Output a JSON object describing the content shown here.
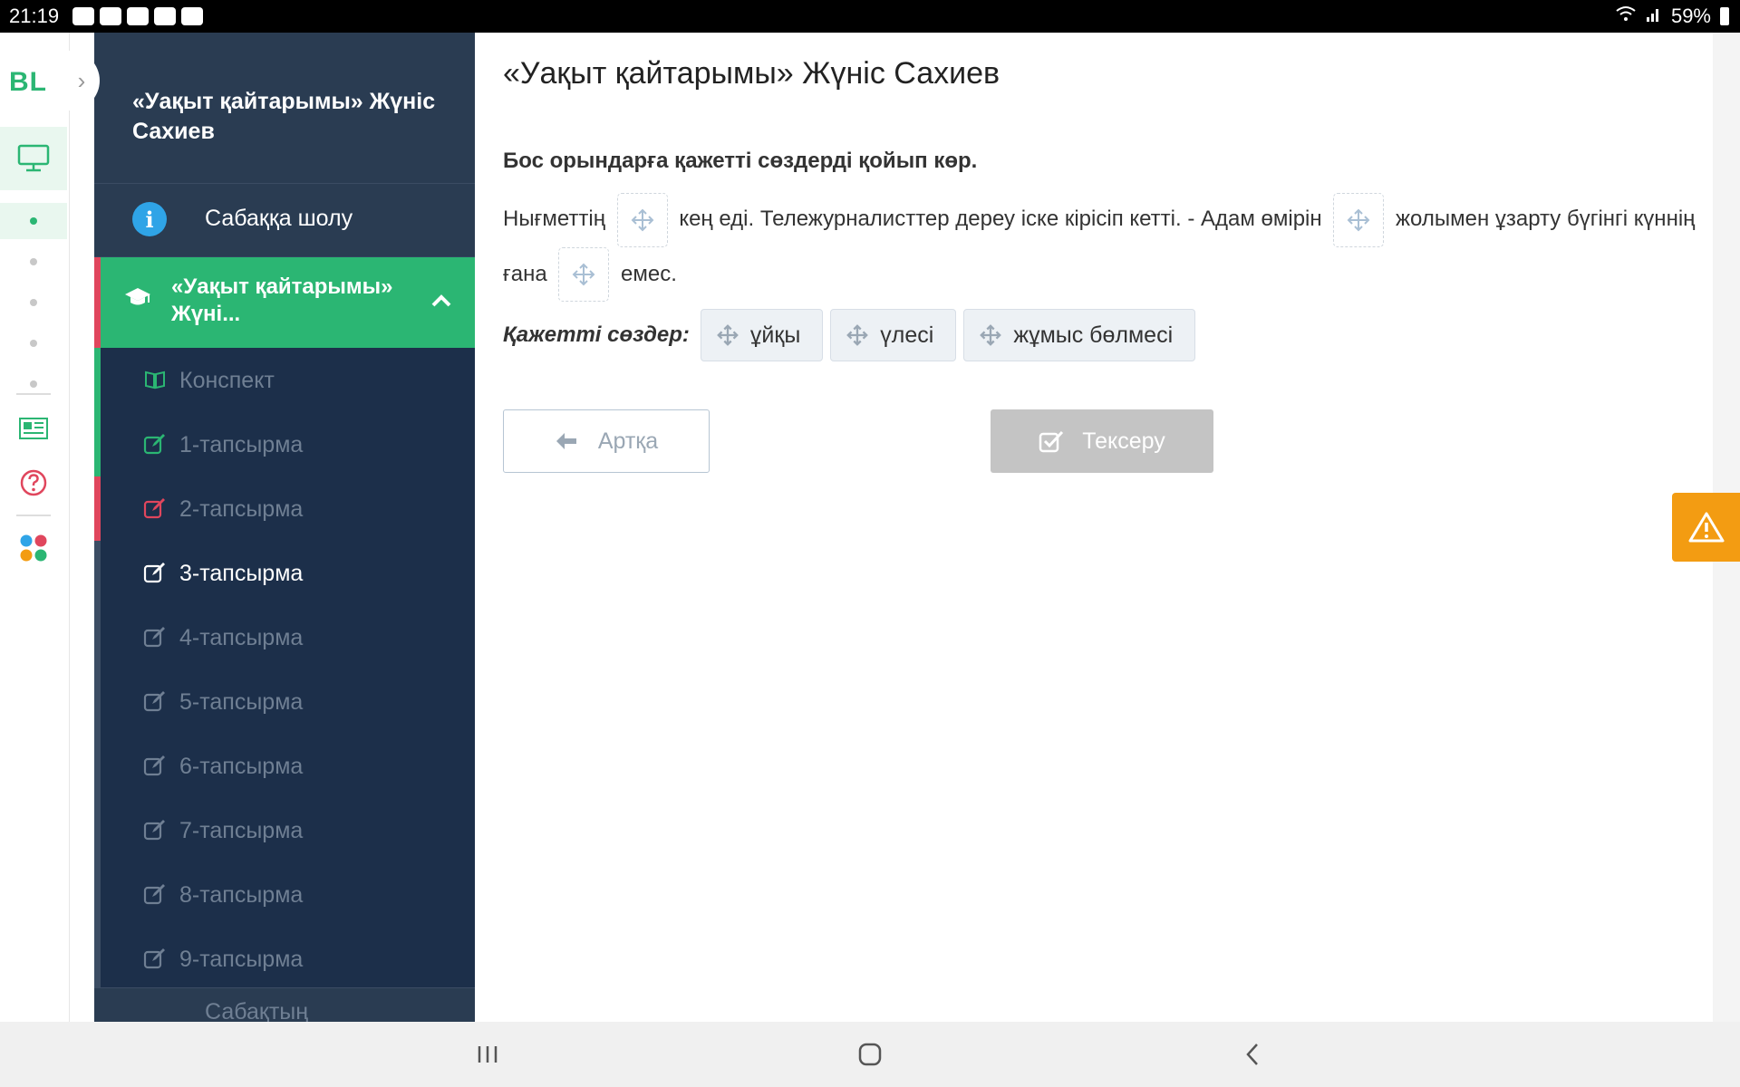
{
  "statusbar": {
    "time": "21:19",
    "battery": "59%"
  },
  "rail": {
    "logo": "BL"
  },
  "sidebar": {
    "lesson_title": "«Уақыт қайтарымы» Жүніс Сахиев",
    "overview_label": "Сабаққа шолу",
    "active_section": "«Уақыт қайтарымы» Жүні...",
    "items": [
      {
        "label": "Конспект",
        "color": "#2bb673"
      },
      {
        "label": "1-тапсырма",
        "color": "#2bb673"
      },
      {
        "label": "2-тапсырма",
        "color": "#e0465d"
      },
      {
        "label": "3-тапсырма",
        "color": "#ffffff"
      },
      {
        "label": "4-тапсырма",
        "color": "#6f7f93"
      },
      {
        "label": "5-тапсырма",
        "color": "#6f7f93"
      },
      {
        "label": "6-тапсырма",
        "color": "#6f7f93"
      },
      {
        "label": "7-тапсырма",
        "color": "#6f7f93"
      },
      {
        "label": "8-тапсырма",
        "color": "#6f7f93"
      },
      {
        "label": "9-тапсырма",
        "color": "#6f7f93"
      }
    ],
    "footer_label": "Сабақтың"
  },
  "main": {
    "title": "«Уақыт қайтарымы» Жүніс Сахиев",
    "instruction": "Бос орындарға қажетті сөздерді қойып көр.",
    "sentence": {
      "part1": "Нығметтің",
      "part2": "кең еді. Тележурналисттер дереу іске кірісіп кетті. - Адам өмірін",
      "part3": "жолымен ұзарту бүгінгі күннің ғана",
      "part4": "емес."
    },
    "words_label": "Қажетті сөздер:",
    "words": [
      "ұйқы",
      "үлесі",
      "жұмыс бөлмесі"
    ],
    "back_button": "Артқа",
    "check_button": "Тексеру"
  },
  "colors": {
    "accent": "#2bb673",
    "sidebar_bg": "#1c2f4a",
    "warning": "#f39c12",
    "danger": "#e0465d"
  }
}
